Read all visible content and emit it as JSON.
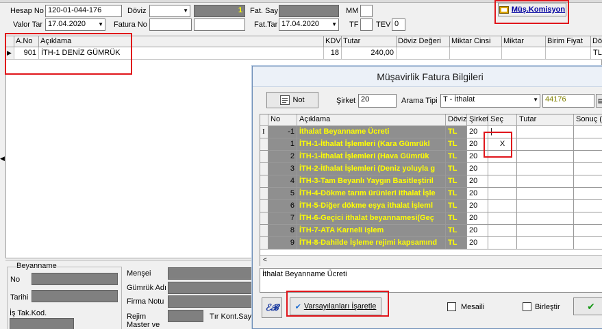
{
  "header": {
    "hesap_no_label": "Hesap No",
    "hesap_no_value": "120-01-044-176",
    "doviz_label": "Döviz",
    "doviz_value": "",
    "doviz_rate": "1",
    "fat_say_label": "Fat. Say",
    "mm_label": "MM",
    "valor_tar_label": "Valor Tar",
    "valor_tar_value": "17.04.2020",
    "fatura_no_label": "Fatura No",
    "fat_tar_label": "Fat.Tar",
    "fat_tar_value": "17.04.2020",
    "tf_label": "TF",
    "tev_label": "TEV",
    "tev_value": "0",
    "mus_komisyon_label": "Müş.Komisyon"
  },
  "main_grid": {
    "columns": [
      "A.No",
      "Açıklama",
      "KDV",
      "Tutar",
      "Döviz Değeri",
      "Miktar Cinsi",
      "Miktar",
      "Birim Fiyat",
      "Döv"
    ],
    "row": {
      "a_no": "901",
      "aciklama": "İTH-1 DENİZ GÜMRÜK",
      "kdv": "18",
      "tutar": "240,00",
      "doviz": "TL"
    }
  },
  "bottom_panel": {
    "beyanname_label": "Beyanname",
    "no_label": "No",
    "tarihi_label": "Tarihi",
    "is_tak_kod_label": "İş Tak.Kod.",
    "mensei_label": "Menşei",
    "gumruk_adi_label": "Gümrük Adı",
    "firma_notu_label": "Firma Notu",
    "rejim_label": "Rejim",
    "tir_kont_say_label": "Tır Kont.Say",
    "master_ve_label": "Master ve"
  },
  "dialog": {
    "title": "Müşavirlik Fatura Bilgileri",
    "not_button": "Not",
    "sirket_label": "Şirket",
    "sirket_value": "20",
    "arama_tipi_label": "Arama Tipi",
    "arama_tipi_value": "T - İthalat",
    "code_value": "44176",
    "columns": [
      "No",
      "Açıklama",
      "Döviz",
      "Şirket",
      "Seç",
      "Tutar",
      "Sonuç (I"
    ],
    "rows": [
      {
        "no": "-1",
        "aciklama": "İthalat Beyanname Ücreti",
        "doviz": "TL",
        "sirket": "20",
        "sec": "|"
      },
      {
        "no": "1",
        "aciklama": "İTH-1-İthalat İşlemleri  (Kara Gümrükl",
        "doviz": "TL",
        "sirket": "20",
        "sec": "X"
      },
      {
        "no": "2",
        "aciklama": "İTH-1-İthalat İşlemleri  (Hava Gümrük",
        "doviz": "TL",
        "sirket": "20",
        "sec": ""
      },
      {
        "no": "3",
        "aciklama": "İTH-2-İthalat İşlemleri (Deniz yoluyla g",
        "doviz": "TL",
        "sirket": "20",
        "sec": ""
      },
      {
        "no": "4",
        "aciklama": "İTH-3-Tam Beyanlı Yaygın Basitleştiril",
        "doviz": "TL",
        "sirket": "20",
        "sec": ""
      },
      {
        "no": "5",
        "aciklama": "İTH-4-Dökme tarım ürünleri ithalat İşle",
        "doviz": "TL",
        "sirket": "20",
        "sec": ""
      },
      {
        "no": "6",
        "aciklama": "İTH-5-Diğer dökme eşya ithalat İşleml",
        "doviz": "TL",
        "sirket": "20",
        "sec": ""
      },
      {
        "no": "7",
        "aciklama": "İTH-6-Geçici ithalat beyannamesi(Geç",
        "doviz": "TL",
        "sirket": "20",
        "sec": ""
      },
      {
        "no": "8",
        "aciklama": "İTH-7-ATA Karneli işlem",
        "doviz": "TL",
        "sirket": "20",
        "sec": ""
      },
      {
        "no": "9",
        "aciklama": "İTH-8-Dahilde İşleme rejimi kapsamınd",
        "doviz": "TL",
        "sirket": "20",
        "sec": ""
      }
    ],
    "memo_text": "İthalat Beyanname Ücreti",
    "varsayilan_button": "Varsayılanları İşaretle",
    "mesaili_label": "Mesaili",
    "birlestir_label": "Birleştir"
  },
  "colors": {
    "highlight_red": "#e0151b",
    "yellow_text": "#ffff00",
    "row_gray": "#8f8f8f"
  }
}
